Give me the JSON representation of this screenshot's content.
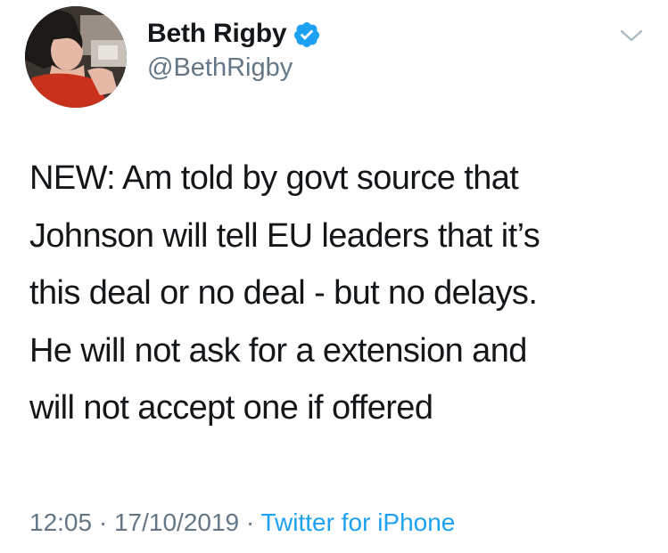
{
  "author": {
    "display_name": "Beth Rigby",
    "handle": "@BethRigby",
    "verified": true,
    "avatar_icon": "profile-photo"
  },
  "tweet": {
    "lines": [
      "NEW: Am told by govt source that",
      "Johnson will tell EU leaders that it’s",
      "this deal or no deal - but no delays.",
      "He will not ask for a extension and",
      "will not accept one if offered"
    ]
  },
  "meta": {
    "time": "12:05",
    "separator": " · ",
    "date": "17/10/2019",
    "source": "Twitter for iPhone"
  },
  "icons": {
    "verified": "verified-badge-icon",
    "menu": "chevron-down-icon"
  },
  "colors": {
    "text": "#14171a",
    "secondary": "#657786",
    "link": "#1da1f2",
    "verified": "#1da1f2"
  }
}
